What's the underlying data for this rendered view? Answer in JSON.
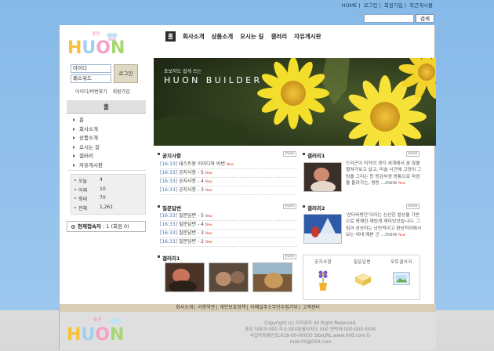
{
  "top_links": [
    "HOME",
    "로그인",
    "회원가입",
    "최근게시물"
  ],
  "search": {
    "button": "검색"
  },
  "logo": {
    "small": "휴온",
    "word": "HUON"
  },
  "gnb": [
    "홈",
    "회사소개",
    "상품소개",
    "오시는 길",
    "갤러리",
    "자유게시판"
  ],
  "login": {
    "id_value": "아이디",
    "pw_value": "패스워드",
    "button": "로그인",
    "links": [
      "아이디/비번찾기",
      "회원가입"
    ]
  },
  "sidebar": {
    "title": "홈",
    "items": [
      "홈",
      "회사소개",
      "상품소개",
      "오시는 길",
      "갤러리",
      "자유게시판"
    ]
  },
  "counter": [
    {
      "label": "오늘",
      "value": "4"
    },
    {
      "label": "어제",
      "value": "10"
    },
    {
      "label": "최대",
      "value": "70"
    },
    {
      "label": "전체",
      "value": "1,261"
    }
  ],
  "online": {
    "label": "현재접속자",
    "value": ": 1 (회원 0)"
  },
  "visual": {
    "subtitle": "초보자도 쉽게 쓰는",
    "title": "HUON BUILDER"
  },
  "notice": {
    "title": "공지사항",
    "more": "more",
    "items": [
      {
        "time": "[16:33]",
        "text": "테스트용 아이디와 비번",
        "new": "New"
      },
      {
        "time": "[16:33]",
        "text": "공지사항 - 5",
        "new": "New"
      },
      {
        "time": "[16:33]",
        "text": "공지사항 - 4",
        "new": "New"
      },
      {
        "time": "[16:33]",
        "text": "공지사항 - 3",
        "new": "New"
      }
    ]
  },
  "qna": {
    "title": "질문답변",
    "more": "more",
    "items": [
      {
        "time": "[16:33]",
        "text": "질문답변 - 5",
        "new": "New"
      },
      {
        "time": "[16:33]",
        "text": "질문답변 - 4",
        "new": "New"
      },
      {
        "time": "[16:33]",
        "text": "질문답변 - 3",
        "new": "New"
      },
      {
        "time": "[16:33]",
        "text": "질문답변 - 2",
        "new": "New"
      }
    ]
  },
  "gallery_bottom": {
    "title": "갤러리1",
    "more": "more"
  },
  "gallery1": {
    "title": "갤러리1",
    "more": "more",
    "text": "드라곤이 미덕의 생각 세계에서 꿈 많을 펼쳐가보고 살고, 미술 시간에 고양이 그림을 그리는 등 동감부생 방통으로 마음을 돌려가는, 명동 ...more",
    "new": "New"
  },
  "gallery2": {
    "title": "갤러리2",
    "more": "more",
    "text": "'산타바방단'이라는 신선한 발상을 기반으로 명쾌한 재밌게 재미있었습니다. 그림이 상상하는 낭만적이고 환상적이에서 보는 내내 예쁜 군 ...more",
    "new": "New"
  },
  "quick": [
    "공지사항",
    "질문답변",
    "포토갤러리"
  ],
  "footer": {
    "nav": [
      "회사소개",
      "이용약관",
      "개인보호정책",
      "이메일주소무단수집거부",
      "고객센터"
    ],
    "lines": [
      "Copyright (c) 저작권자 All Right Reserved.",
      "휴온 대표자:000 주소:000특별자치도 000 연락처:000-000-0000",
      "사업자등록번호:618-00-00000 SiteURL:www.000.com E-mail:00@000.com"
    ]
  }
}
